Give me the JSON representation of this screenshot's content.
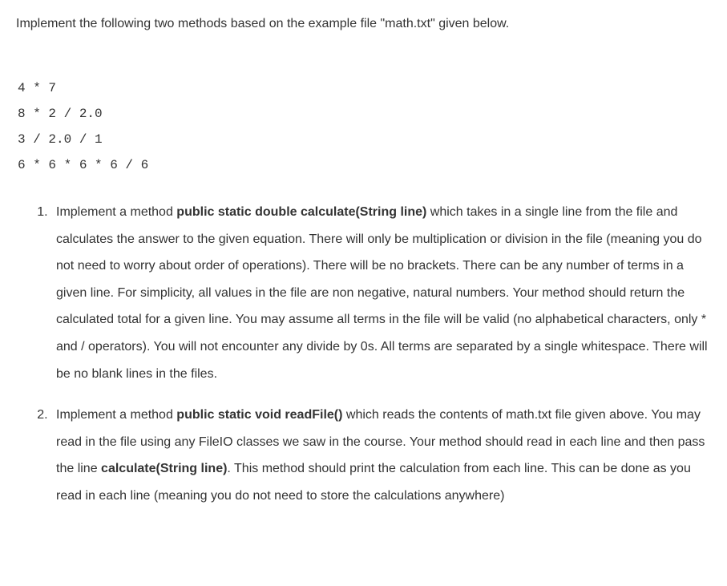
{
  "intro": "Implement the following two methods based on the example file \"math.txt\" given below.",
  "code_lines": [
    "4 * 7",
    "8 * 2 / 2.0",
    "3 / 2.0 / 1",
    "6 * 6 * 6 * 6 / 6"
  ],
  "questions": [
    {
      "pre": "Implement a method ",
      "bold": "public static double calculate(String line)",
      "post": " which takes in a single line from the file and calculates the answer to the given equation. There will only be multiplication or division in the file (meaning you do not need to worry about order of operations). There will be no brackets. There can be any number of terms in a given line. For simplicity, all values in the file are non negative, natural numbers. Your method should return the calculated total for a given line. You may assume all terms in the file will be valid (no alphabetical characters, only * and / operators). You will not encounter any divide by 0s. All terms are separated by a single whitespace. There will be no blank lines in the files."
    },
    {
      "pre": "Implement a method ",
      "bold": "public static void readFile()",
      "post_parts": [
        " which reads the contents of math.txt file given above. You may read in the file using any FileIO classes we saw in the course. Your method should read in each line and then pass the line ",
        ". This method should print the calculation from each line. This can be done as you read in each line (meaning you do not need to store the calculations anywhere)"
      ],
      "inner_bold": "calculate(String line)"
    }
  ]
}
